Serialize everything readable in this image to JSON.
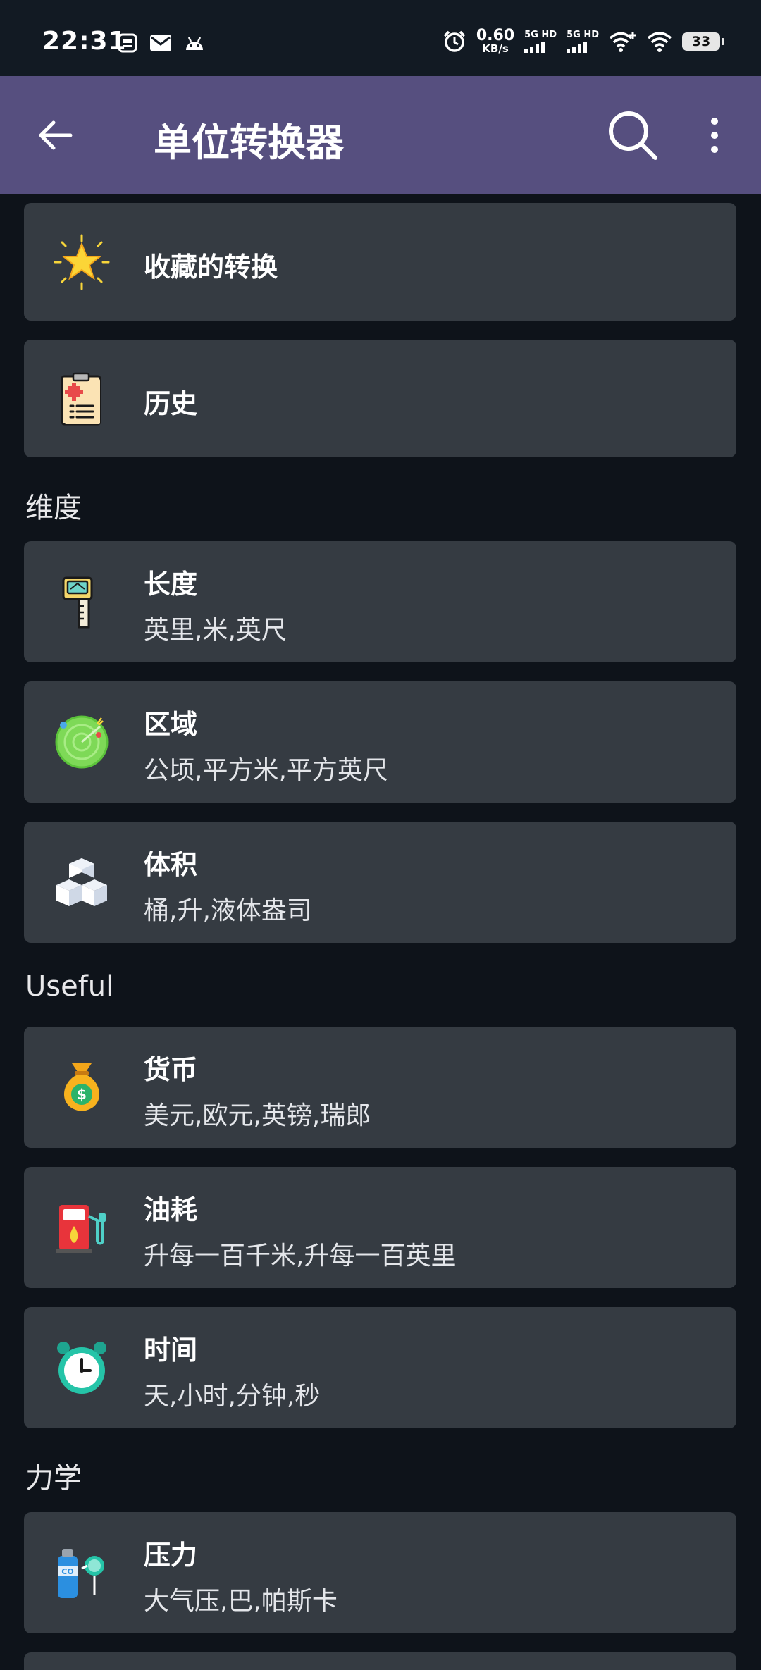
{
  "status_bar": {
    "time": "22:31",
    "net_speed_value": "0.60",
    "net_speed_unit": "KB/s",
    "sim1_label": "5G HD",
    "sim2_label": "5G HD",
    "battery": "33"
  },
  "app_bar": {
    "title": "单位转换器"
  },
  "top_items": [
    {
      "title": "收藏的转换"
    },
    {
      "title": "历史"
    }
  ],
  "sections": {
    "dimensions": "维度",
    "useful": "Useful",
    "mechanics": "力学"
  },
  "items": {
    "length": {
      "title": "长度",
      "subtitle": "英里,米,英尺"
    },
    "area": {
      "title": "区域",
      "subtitle": "公顷,平方米,平方英尺"
    },
    "volume": {
      "title": "体积",
      "subtitle": "桶,升,液体盎司"
    },
    "currency": {
      "title": "货币",
      "subtitle": "美元,欧元,英镑,瑞郎"
    },
    "fuel": {
      "title": "油耗",
      "subtitle": "升每一百千米,升每一百英里"
    },
    "time": {
      "title": "时间",
      "subtitle": "天,小时,分钟,秒"
    },
    "pressure": {
      "title": "压力",
      "subtitle": "大气压,巴,帕斯卡"
    }
  },
  "icons": {
    "favorites": "star-icon",
    "history": "clipboard-icon",
    "length": "tape-measure-icon",
    "area": "radar-icon",
    "volume": "cubes-icon",
    "currency": "money-bag-icon",
    "fuel": "gas-pump-icon",
    "time": "alarm-clock-icon",
    "pressure": "gas-cylinder-icon"
  },
  "colors": {
    "app_bar": "#564f7f",
    "background": "#0e131a",
    "card": "#353b42"
  }
}
